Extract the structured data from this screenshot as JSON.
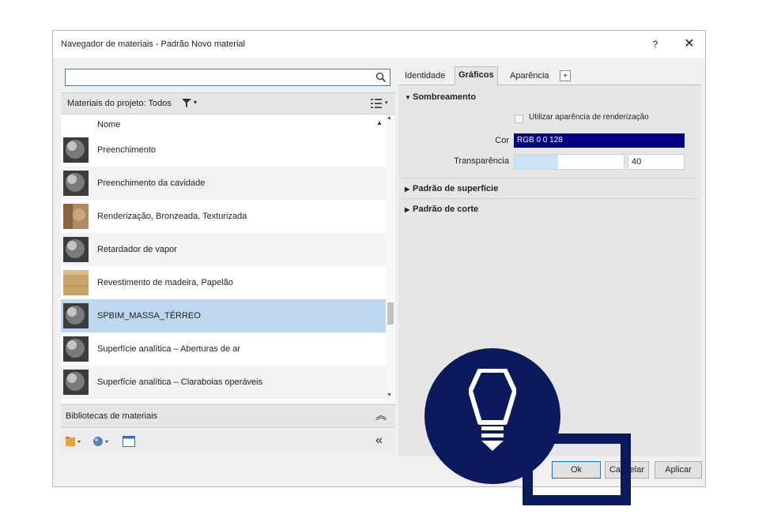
{
  "dialog": {
    "title": "Navegador de materiais - Padrão Novo material",
    "help_label": "?",
    "close_label": "✕"
  },
  "left": {
    "search": {
      "value": "",
      "placeholder": ""
    },
    "project_materials_label": "Materiais do projeto: Todos",
    "list_header": "Nome",
    "materials": [
      {
        "name": "Preenchimento",
        "thumb": "gray-sphere"
      },
      {
        "name": "Preenchimento da cavidade",
        "thumb": "gray-sphere"
      },
      {
        "name": "Renderização, Bronzeada, Texturizada",
        "thumb": "tan-texture"
      },
      {
        "name": "Retardador de vapor",
        "thumb": "gray-sphere"
      },
      {
        "name": "Revestimento de madeira, Papelão",
        "thumb": "cardboard"
      },
      {
        "name": "SPBIM_MASSA_TÉRREO",
        "thumb": "gray-sphere",
        "selected": true
      },
      {
        "name": "Superfície analítica – Aberturas de ar",
        "thumb": "gray-sphere"
      },
      {
        "name": "Superfície analítica – Claraboias operáveis",
        "thumb": "gray-sphere"
      }
    ],
    "libraries_label": "Bibliotecas de materiais"
  },
  "right": {
    "tabs": [
      {
        "label": "Identidade"
      },
      {
        "label": "Gráficos",
        "active": true
      },
      {
        "label": "Aparência"
      }
    ],
    "tab_add": "+",
    "shading": {
      "title": "Sombreamento",
      "use_render_label": "Utilizar aparência de renderização",
      "use_render_checked": false,
      "color_label": "Cor",
      "color_value": "RGB 0 0 128",
      "color_hex": "#000080",
      "transparency_label": "Transparência",
      "transparency_value": "40",
      "transparency_fraction": 0.4
    },
    "surface_pattern": "Padrão de superfície",
    "cut_pattern": "Padrão de corte"
  },
  "buttons": {
    "ok": "Ok",
    "cancel": "Cancelar",
    "apply": "Aplicar"
  },
  "overlay": {
    "circle_color": "#0a1a5c",
    "icon": "lightbulb-icon"
  }
}
